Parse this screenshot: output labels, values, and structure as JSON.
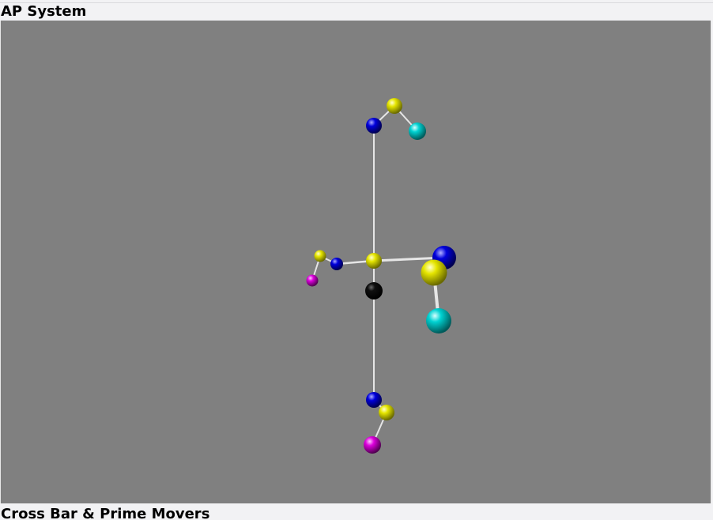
{
  "panels": {
    "top_title": "AP System",
    "bottom_title": "Cross Bar & Prime Movers"
  },
  "colors": {
    "background": "#808080",
    "yellow": "#d9d900",
    "blue": "#0000c8",
    "cyan": "#00c8c8",
    "magenta": "#c800c8",
    "black": "#000000",
    "rod": "#e6e6e6"
  },
  "scene": {
    "nodes": [
      {
        "id": "top-yellow",
        "color": "yellow"
      },
      {
        "id": "top-blue",
        "color": "blue"
      },
      {
        "id": "top-cyan",
        "color": "cyan"
      },
      {
        "id": "center-yellow",
        "color": "yellow"
      },
      {
        "id": "center-black",
        "color": "black"
      },
      {
        "id": "left-blue",
        "color": "blue"
      },
      {
        "id": "left-yellow",
        "color": "yellow"
      },
      {
        "id": "left-magenta",
        "color": "magenta"
      },
      {
        "id": "right-blue",
        "color": "blue"
      },
      {
        "id": "right-yellow",
        "color": "yellow"
      },
      {
        "id": "right-cyan",
        "color": "cyan"
      },
      {
        "id": "bottom-blue",
        "color": "blue"
      },
      {
        "id": "bottom-yellow",
        "color": "yellow"
      },
      {
        "id": "bottom-magenta",
        "color": "magenta"
      }
    ],
    "links": [
      [
        "top-blue",
        "top-yellow"
      ],
      [
        "top-yellow",
        "top-cyan"
      ],
      [
        "top-blue",
        "center-yellow"
      ],
      [
        "center-yellow",
        "center-black"
      ],
      [
        "center-black",
        "bottom-blue"
      ],
      [
        "center-yellow",
        "left-blue"
      ],
      [
        "left-blue",
        "left-yellow"
      ],
      [
        "left-yellow",
        "left-magenta"
      ],
      [
        "center-yellow",
        "right-blue"
      ],
      [
        "right-blue",
        "right-yellow"
      ],
      [
        "right-yellow",
        "right-cyan"
      ],
      [
        "bottom-blue",
        "bottom-yellow"
      ],
      [
        "bottom-yellow",
        "bottom-magenta"
      ]
    ]
  }
}
